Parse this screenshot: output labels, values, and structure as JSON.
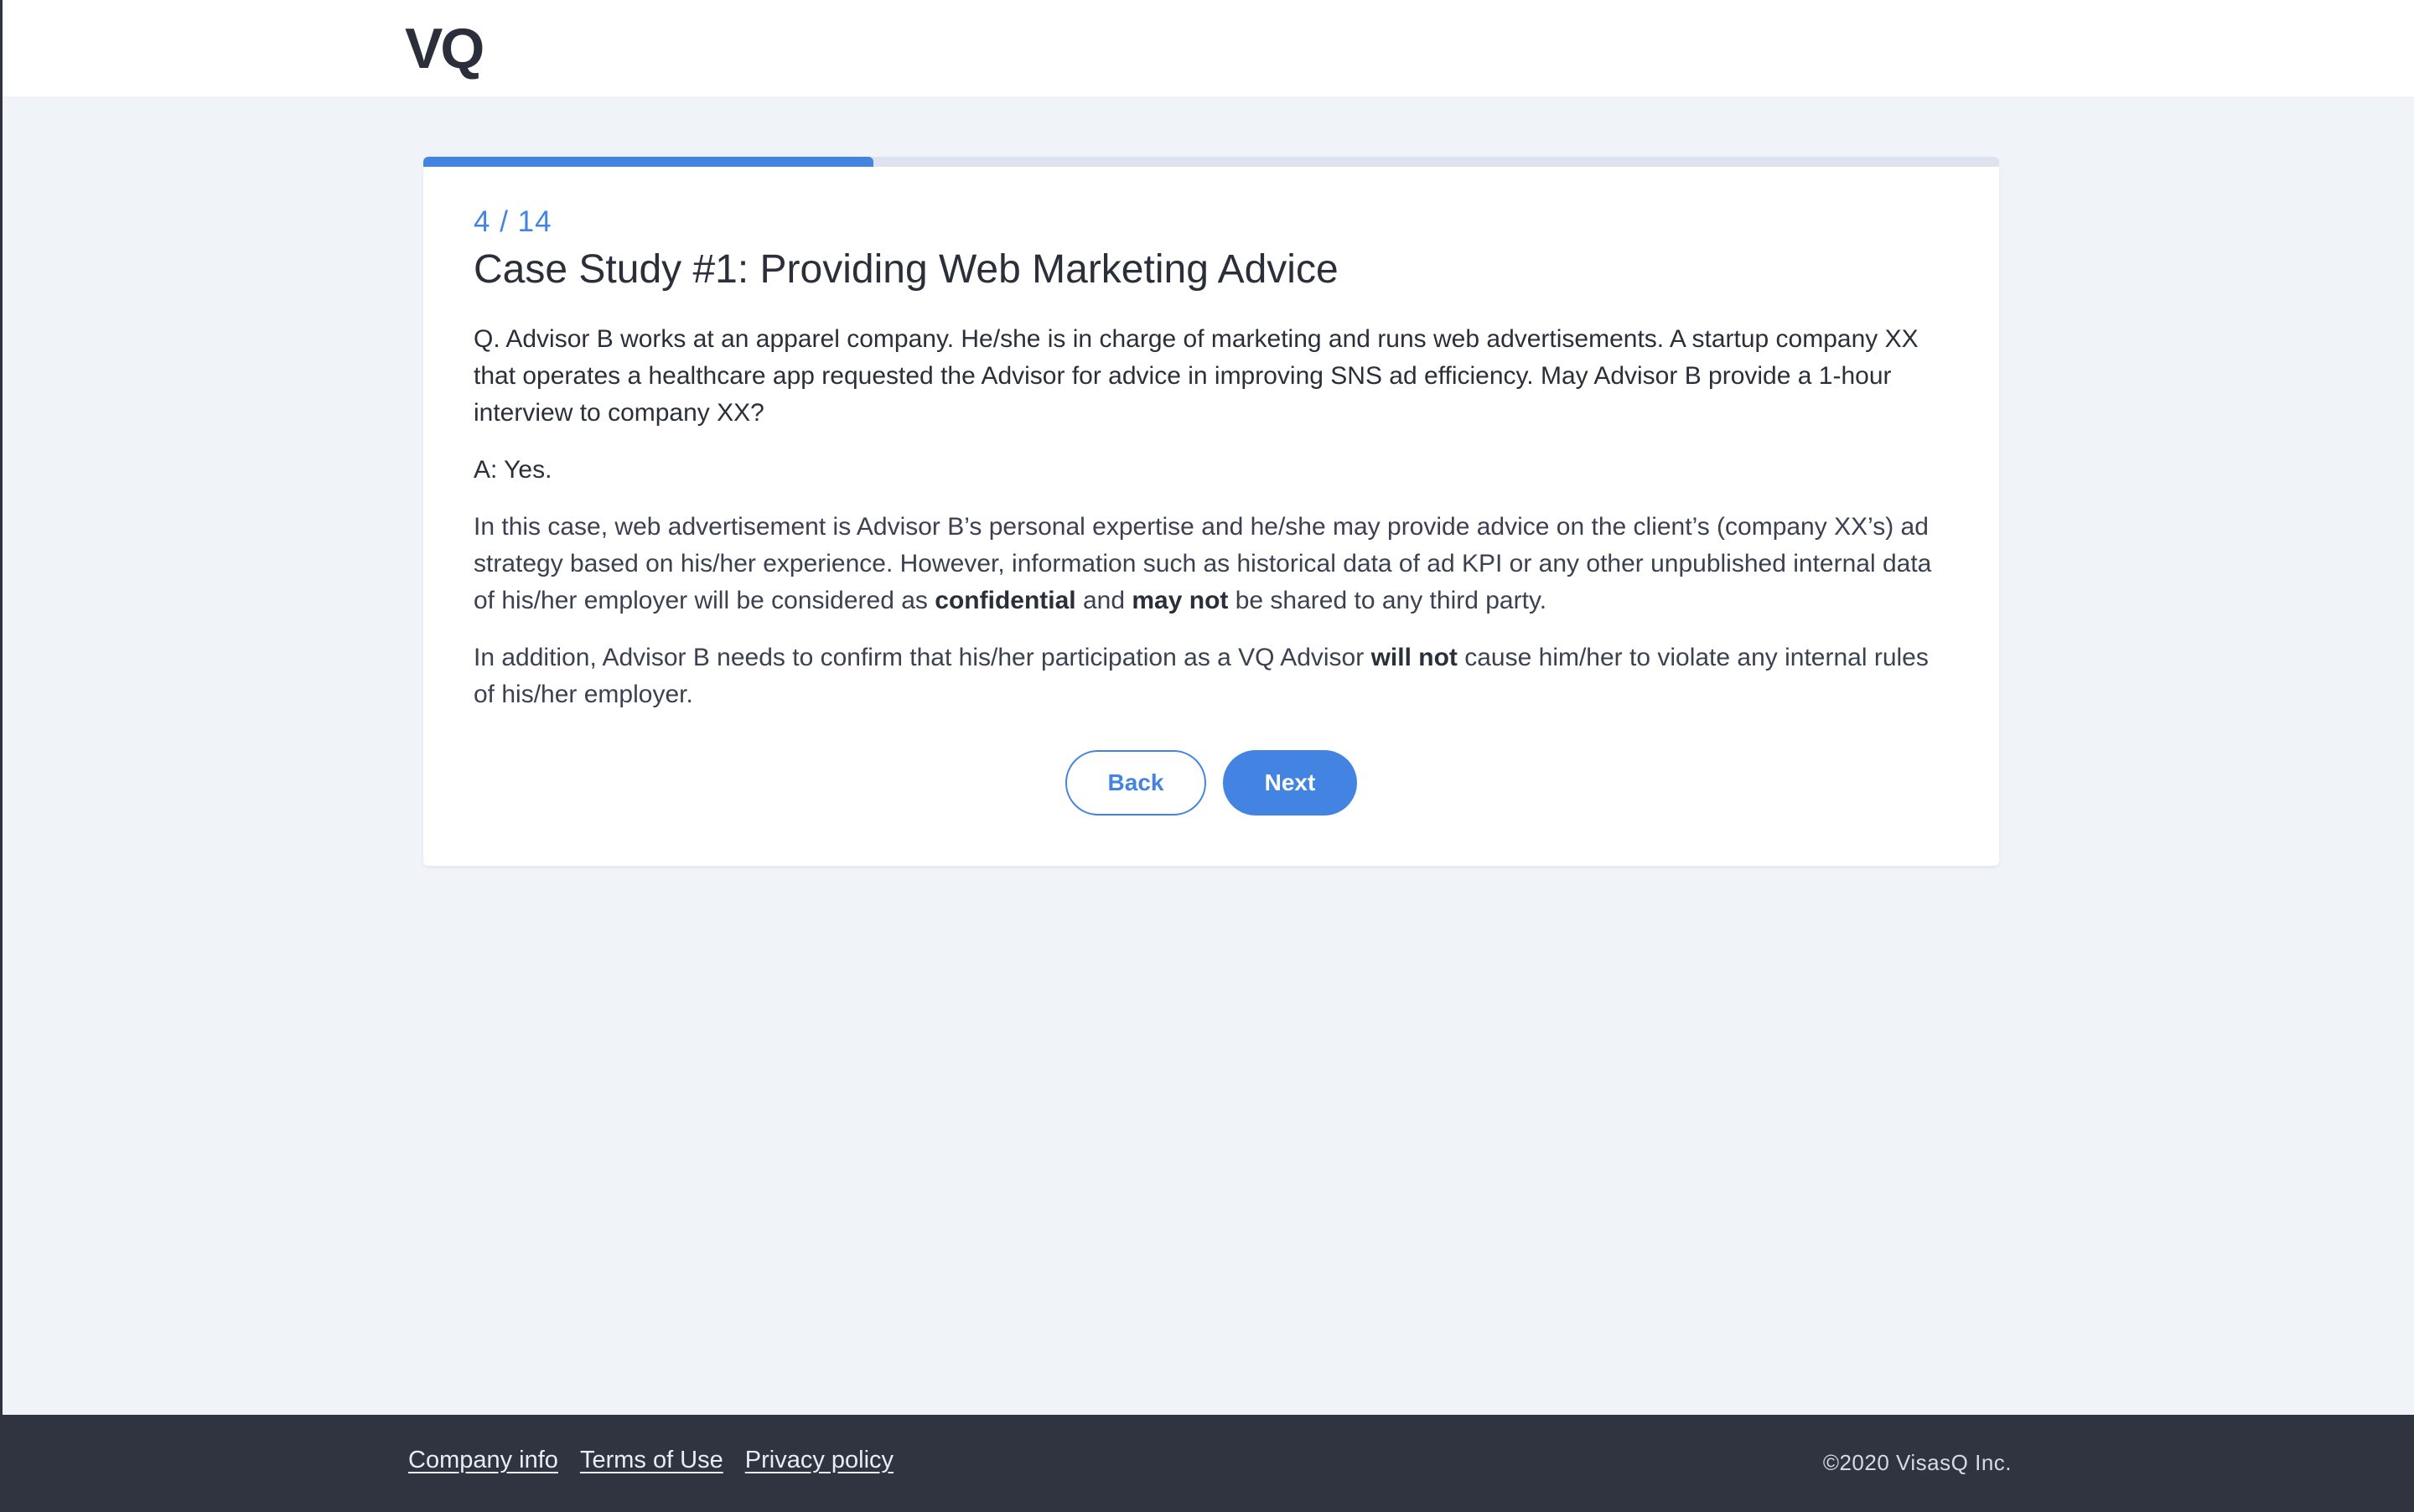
{
  "header": {
    "logo_text": "VQ"
  },
  "progress": {
    "current": 4,
    "total": 14,
    "fraction": 0.2857,
    "label": "4 / 14"
  },
  "card": {
    "title": "Case Study #1: Providing Web Marketing Advice",
    "question": "Q. Advisor B works at an apparel company. He/she is in charge of marketing and runs web advertisements. A startup company XX that operates a healthcare app requested the Advisor for advice in improving SNS ad efficiency. May Advisor B provide a 1-hour interview to company XX?",
    "answer": "A: Yes.",
    "explanation": {
      "part1": "In this case, web advertisement is Advisor B’s personal expertise and he/she may provide advice on the client’s (company XX’s) ad strategy based on his/her experience. However, information such as historical data of ad KPI or any other unpublished internal data of his/her employer will be considered as ",
      "bold1": "confidential",
      "part2": " and ",
      "bold2": "may not",
      "part3": " be shared to any third party."
    },
    "addition": {
      "part1": "In addition, Advisor B needs to confirm that his/her participation as a VQ Advisor ",
      "bold1": "will not",
      "part2": " cause him/her to violate any internal rules of his/her employer."
    },
    "back_label": "Back",
    "next_label": "Next"
  },
  "footer": {
    "links": [
      "Company info",
      "Terms of Use",
      "Privacy policy"
    ],
    "copyright": "©2020 VisasQ Inc."
  },
  "colors": {
    "accent": "#4384e3",
    "footer_bg": "#2f3440",
    "page_bg": "#f0f3f8"
  }
}
